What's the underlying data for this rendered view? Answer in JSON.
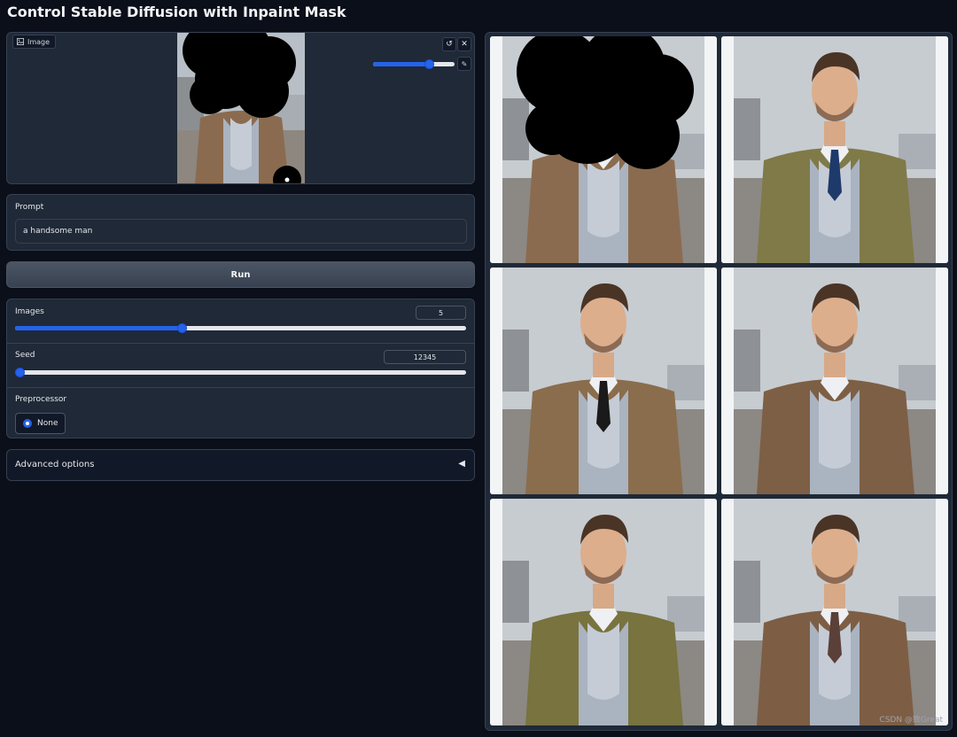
{
  "page": {
    "title": "Control Stable Diffusion with Inpaint Mask"
  },
  "image_panel": {
    "label": "Image",
    "undo_icon": "undo-icon",
    "clear_icon": "close-icon",
    "brush_icon": "brush-icon",
    "brush_size_level": 0.68
  },
  "prompt": {
    "label": "Prompt",
    "value": "a handsome man"
  },
  "run_button": {
    "label": "Run"
  },
  "settings": {
    "images": {
      "label": "Images",
      "value": "5",
      "level": 0.37
    },
    "seed": {
      "label": "Seed",
      "value": "12345",
      "level": 0.0
    },
    "preprocessor": {
      "label": "Preprocessor",
      "selected": "None"
    }
  },
  "advanced": {
    "label": "Advanced options",
    "arrow": "◀"
  },
  "gallery": {
    "items": [
      {
        "kind": "masked",
        "coat": "#8b6b4f",
        "tie": ""
      },
      {
        "kind": "man",
        "coat": "#7f7a48",
        "tie": "#1e3a6b"
      },
      {
        "kind": "man",
        "coat": "#8a6d4c",
        "tie": "#1a1a1a"
      },
      {
        "kind": "man",
        "coat": "#7d5f45",
        "tie": ""
      },
      {
        "kind": "man",
        "coat": "#78733f",
        "tie": ""
      },
      {
        "kind": "man",
        "coat": "#7d5e44",
        "tie": "#5a4038"
      }
    ]
  },
  "watermark": "CSDN @致Great",
  "colors": {
    "accent": "#2563eb",
    "background": "#0b0f19",
    "panel": "#1f2937",
    "border": "#374151"
  }
}
